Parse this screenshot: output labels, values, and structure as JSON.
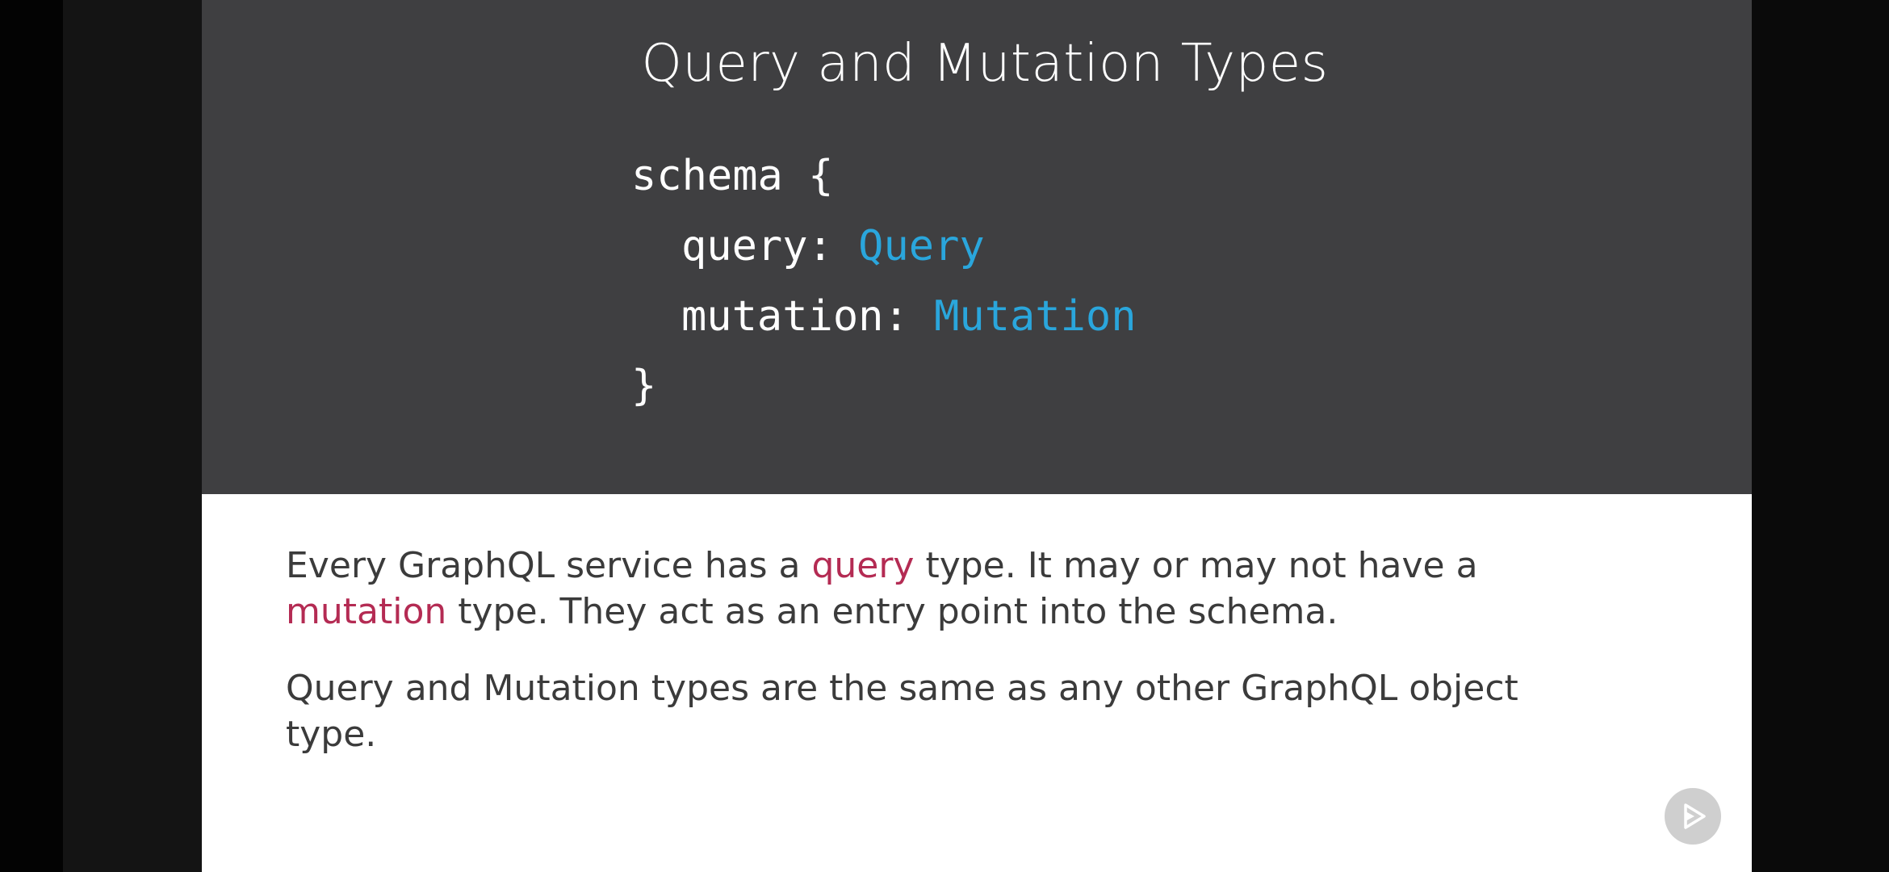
{
  "slide": {
    "title": "Query and Mutation Types",
    "code": {
      "line1": "schema {",
      "line2_key": "query: ",
      "line2_type": "Query",
      "line3_key": "mutation: ",
      "line3_type": "Mutation",
      "line4": "}"
    },
    "paragraph1": {
      "part1": "Every GraphQL service has a ",
      "highlight1": "query",
      "part2": " type. It may or may not have a ",
      "highlight2": "mutation",
      "part3": " type. They act as an entry point into the schema."
    },
    "paragraph2": "Query and Mutation types are the same as any other GraphQL object type."
  },
  "overlay": {
    "play_icon": "play-badge-icon"
  },
  "colors": {
    "slide_header_bg": "#3f3f41",
    "code_type": "#2aa6dc",
    "highlight": "#b42b53",
    "body_text": "#3b3b3b"
  }
}
